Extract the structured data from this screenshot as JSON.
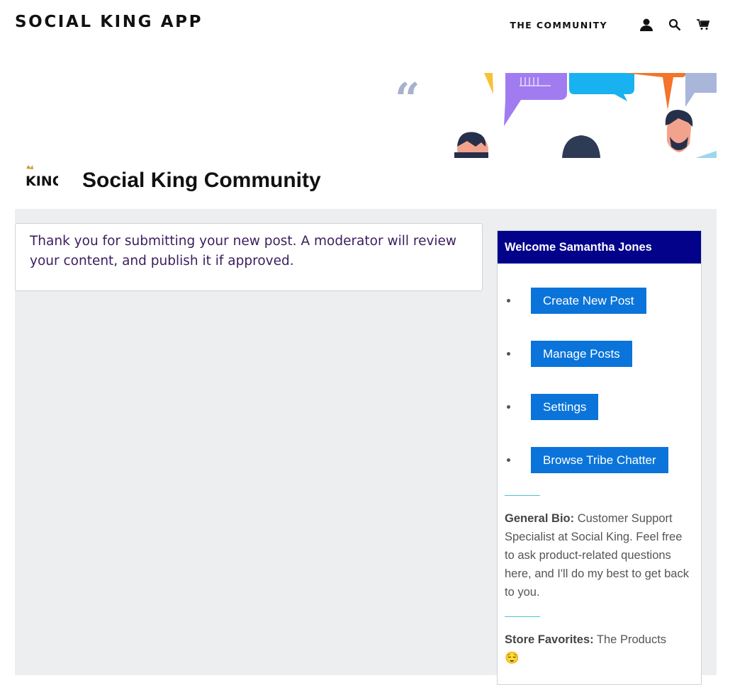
{
  "header": {
    "site_title": "SOCIAL KING APP",
    "nav_link": "THE COMMUNITY",
    "icons": [
      "account-icon",
      "search-icon",
      "cart-icon"
    ]
  },
  "community": {
    "logo_text": "KING",
    "title": "Social King Community"
  },
  "notice": {
    "message": "Thank you for submitting your new post. A moderator will review your content, and publish it if approved."
  },
  "sidebar": {
    "welcome": "Welcome Samantha Jones",
    "buttons": [
      "Create New Post",
      "Manage Posts",
      "Settings",
      "Browse Tribe Chatter"
    ],
    "bio_label": "General Bio:",
    "bio_text": "Customer Support Specialist at Social King. Feel free to ask product-related questions here, and I'll do my best to get back to you.",
    "favorites_label": "Store Favorites:",
    "favorites_text": "The Products",
    "favorites_emoji": "😌"
  },
  "colors": {
    "sidebar_header": "#02028a",
    "button": "#0a74da",
    "notice_text": "#3b1d5e",
    "divider": "#49c6d6",
    "main_bg": "#eceef0"
  }
}
